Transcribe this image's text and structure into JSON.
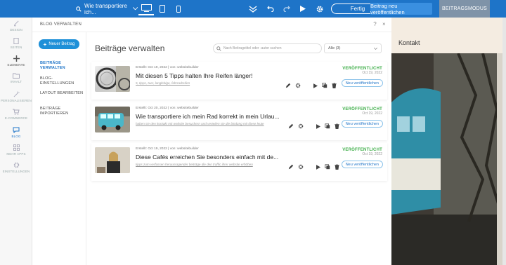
{
  "topbar": {
    "page_select": "Wie transportiere ich...",
    "fertig": "Fertig",
    "publish": "Beitrag neu veröffentlichen",
    "mode": "BEITRAGSMODUS",
    "colors": {
      "bar": "#1e74c8",
      "mode": "#7f93a8"
    }
  },
  "sidebar": {
    "items": [
      {
        "label": "DESIGN",
        "icon": "brush-icon"
      },
      {
        "label": "SEITEN",
        "icon": "pages-icon"
      },
      {
        "label": "ELEMENTE",
        "icon": "plus-icon"
      },
      {
        "label": "INHALT",
        "icon": "folder-icon"
      },
      {
        "label": "PERSONALISIEREN",
        "icon": "wand-icon"
      },
      {
        "label": "E-COMMERCE",
        "icon": "cart-icon"
      },
      {
        "label": "BLOG",
        "icon": "chat-icon"
      },
      {
        "label": "MEHR APPS",
        "icon": "grid-icon"
      },
      {
        "label": "EINSTELLUNGEN",
        "icon": "gear-icon"
      }
    ]
  },
  "panel": {
    "header": "BLOG VERWALTEN",
    "help": "?",
    "close": "×",
    "new_post": "Neuer Beitrag",
    "nav": [
      "BEITRÄGE VERWALTEN",
      "BLOG-EINSTELLUNGEN",
      "LAYOUT BEARBEITEN",
      "BEITRÄGE IMPORTIEREN"
    ],
    "title": "Beiträge verwalten",
    "search_placeholder": "Nach Beitragstitel oder -autor suchen",
    "filter": "Alle (3)"
  },
  "posts": [
    {
      "meta": "Erstellt: Oct 19, 2022 | von: websitebuilder",
      "title": "Mit diesen 5 Tipps halten Ihre Reifen länger!",
      "subtitle": "5, tipps, tuer, langlebige, fahrradreifen",
      "status": "VERÖFFENTLICHT",
      "date": "Oct 19, 2022",
      "republish": "Neu veröffentlichen"
    },
    {
      "meta": "Erstellt: Oct 20, 2022 | von: websitebuilder",
      "title": "Wie transportiere ich mein Rad korrekt in mein Urlau...",
      "subtitle": "haben sie den kontakt mit website besuchern und verteilen sie die bindung mit diese leute",
      "status": "VERÖFFENTLICHT",
      "date": "Oct 19, 2022",
      "republish": "Neu veröffentlichen"
    },
    {
      "meta": "Erstellt: Oct 19, 2022 | von: websitebuilder",
      "title": "Diese Cafés erreichen Sie besonders einfach mit de...",
      "subtitle": "tipps zum verfassen herausragender beiträge die den traffic ihrer website erhöhen",
      "status": "VERÖFFENTLICHT",
      "date": "Oct 19, 2022",
      "republish": "Neu veröffentlichen"
    }
  ],
  "preview": {
    "heading": "Kontakt"
  }
}
